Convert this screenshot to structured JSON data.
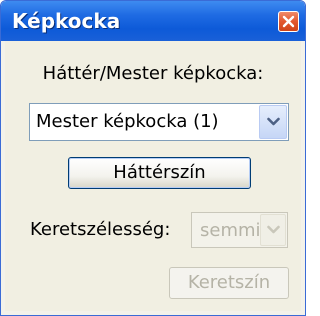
{
  "window": {
    "title": "Képkocka",
    "close_icon": "close-icon"
  },
  "background_master": {
    "label": "Háttér/Mester képkocka:",
    "selected": "Mester képkocka (1)",
    "dropdown_icon": "chevron-down-icon"
  },
  "background_color_button": {
    "label": "Háttérszín"
  },
  "frame_width": {
    "label": "Keretszélesség:",
    "selected": "semmi",
    "disabled": true,
    "dropdown_icon": "chevron-down-icon"
  },
  "frame_color_button": {
    "label": "Keretszín",
    "disabled": true
  },
  "colors": {
    "titlebar": "#0d5ad8",
    "close_button": "#e2582f",
    "dialog_background": "#f1efe2",
    "disabled_text": "#b5b3a6"
  }
}
